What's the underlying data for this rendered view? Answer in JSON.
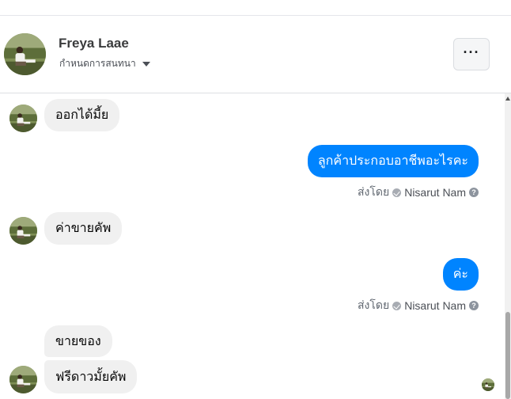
{
  "header": {
    "contact_name": "Freya Laae",
    "settings_label": "กำหนดการสนทนา",
    "more_label": "···"
  },
  "messages": [
    {
      "direction": "in",
      "text": "ออกได้มี้ย"
    },
    {
      "direction": "out",
      "text": "ลูกค้าประกอบอาชีพอะไรคะ"
    },
    {
      "direction": "in",
      "text": "ค่าขายคัพ"
    },
    {
      "direction": "out",
      "text": "ค่ะ"
    },
    {
      "direction": "in",
      "text": "ขายของ"
    },
    {
      "direction": "in",
      "text": "ฟรีดาวมั้ยคัพ"
    }
  ],
  "sent_by": {
    "prefix": "ส่งโดย",
    "agent": "Nisarut Nam",
    "help": "?"
  },
  "colors": {
    "outgoing_bubble": "#0084ff",
    "incoming_bubble": "#f0f0f0",
    "secondary_text": "#606770"
  },
  "icons": {
    "more": "more-horizontal-icon",
    "settings": "chevron-down-icon",
    "verified": "check-circle-icon",
    "help": "help-circle-icon",
    "seen": "seen-avatar-icon"
  }
}
